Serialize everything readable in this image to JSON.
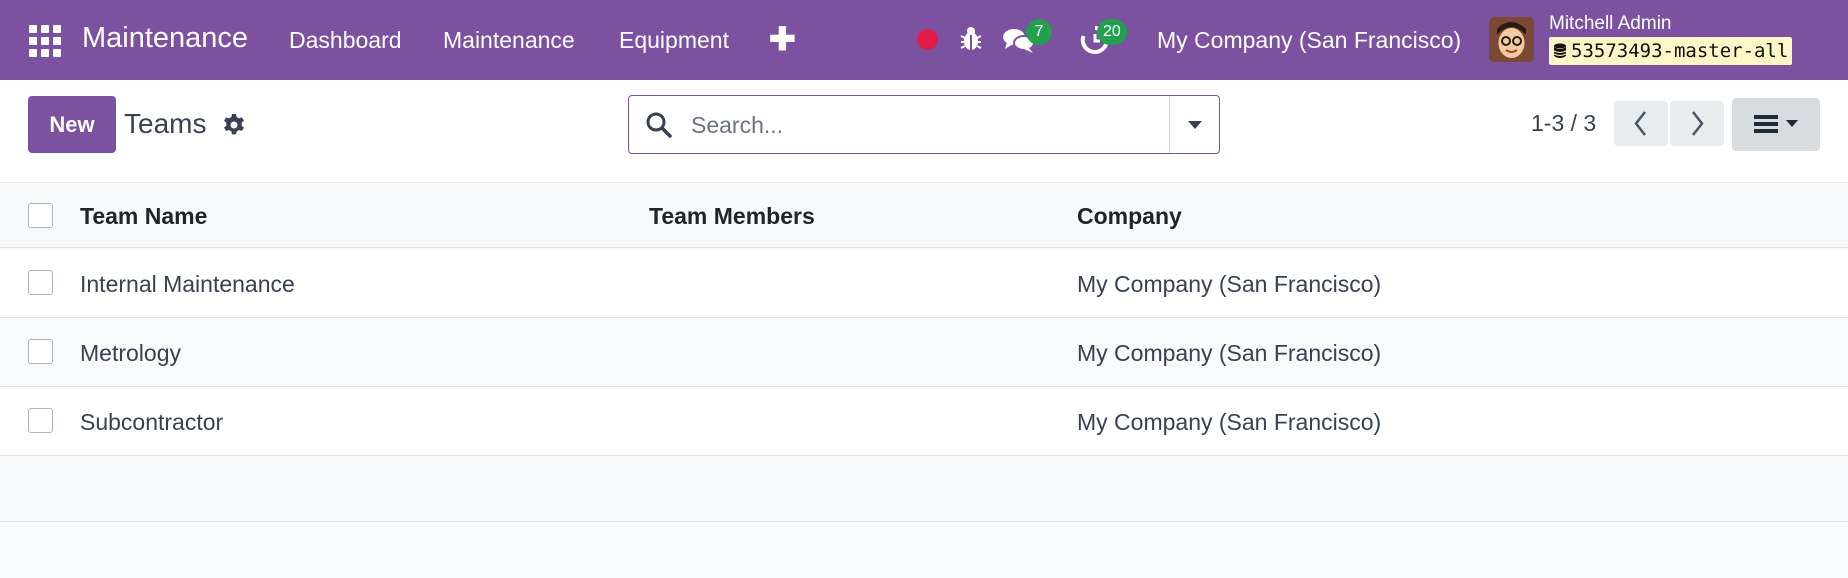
{
  "navbar": {
    "app_name": "Maintenance",
    "menu": [
      {
        "label": "Dashboard"
      },
      {
        "label": "Maintenance"
      },
      {
        "label": "Equipment"
      }
    ],
    "plus_label": "✚",
    "messages_count": "7",
    "activities_count": "20",
    "company": "My Company (San Francisco)",
    "user_name": "Mitchell Admin",
    "database": "53573493-master-all",
    "icons": [
      "apps-icon",
      "record-icon",
      "bug-icon",
      "chat-icon",
      "clock-icon",
      "database-icon"
    ],
    "colors": {
      "navbar": "#7b51a0",
      "badge": "#22a04e",
      "record": "#e11d48"
    }
  },
  "control_panel": {
    "new_label": "New",
    "title": "Teams",
    "search_placeholder": "Search...",
    "pager": "1-3 / 3"
  },
  "table": {
    "columns": [
      "Team Name",
      "Team Members",
      "Company"
    ],
    "rows": [
      {
        "team_name": "Internal Maintenance",
        "team_members": "",
        "company": "My Company (San Francisco)"
      },
      {
        "team_name": "Metrology",
        "team_members": "",
        "company": "My Company (San Francisco)"
      },
      {
        "team_name": "Subcontractor",
        "team_members": "",
        "company": "My Company (San Francisco)"
      }
    ]
  }
}
